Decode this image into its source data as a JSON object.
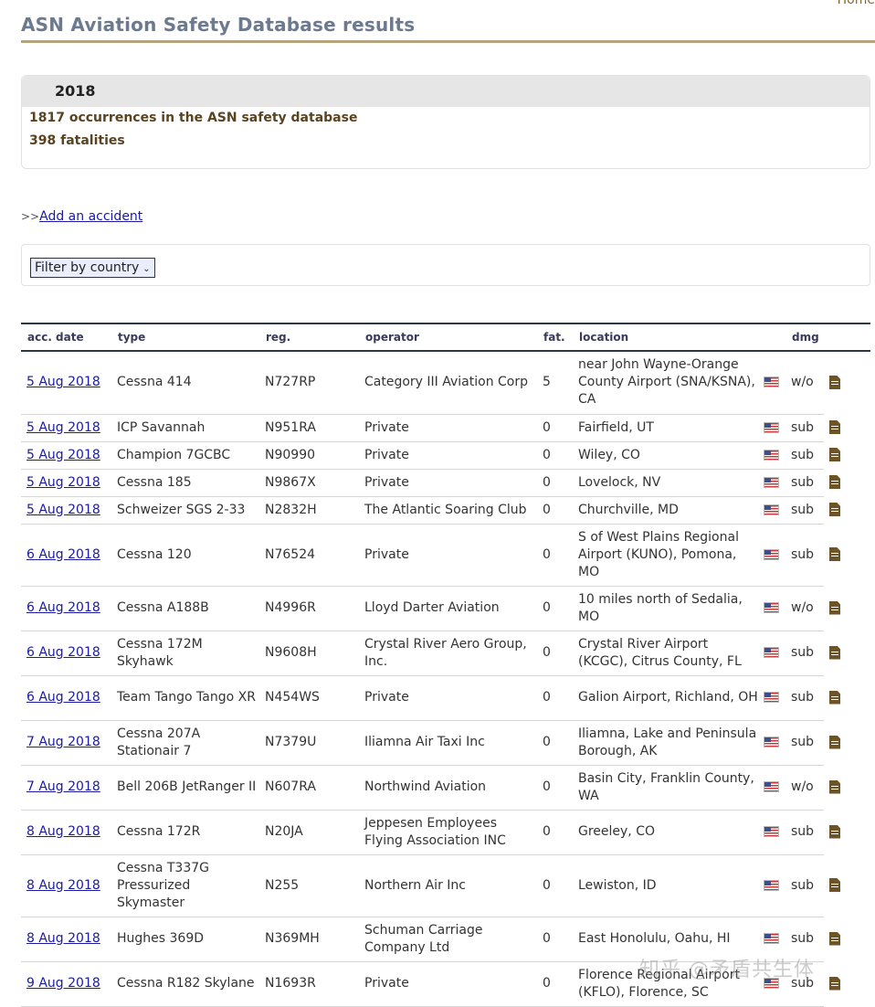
{
  "header": {
    "home_label": "Home",
    "title": "ASN Aviation Safety Database results"
  },
  "stats": {
    "year": "2018",
    "occurrences": "1817 occurrences in the ASN safety database",
    "fatalities": "398 fatalities"
  },
  "add_accident": {
    "arrows": ">>",
    "label": "Add an accident"
  },
  "filter": {
    "selected": "Filter by country"
  },
  "table": {
    "headers": [
      "acc. date",
      "type",
      "reg.",
      "operator",
      "fat.",
      "location",
      "",
      "dmg",
      ""
    ],
    "rows": [
      {
        "date": "5 Aug 2018",
        "type": "Cessna 414",
        "reg": "N727RP",
        "operator": "Category III Aviation Corp",
        "fat": "5",
        "location": "near John Wayne-Orange County Airport (SNA/KSNA), CA",
        "dmg": "w/o",
        "h": 69
      },
      {
        "date": "5 Aug 2018",
        "type": "ICP Savannah",
        "reg": "N951RA",
        "operator": "Private",
        "fat": "0",
        "location": "Fairfield, UT",
        "dmg": "sub",
        "h": 30
      },
      {
        "date": "5 Aug 2018",
        "type": "Champion 7GCBC",
        "reg": "N90990",
        "operator": "Private",
        "fat": "0",
        "location": "Wiley, CO",
        "dmg": "sub",
        "h": 30
      },
      {
        "date": "5 Aug 2018",
        "type": "Cessna 185",
        "reg": "N9867X",
        "operator": "Private",
        "fat": "0",
        "location": "Lovelock, NV",
        "dmg": "sub",
        "h": 30
      },
      {
        "date": "5 Aug 2018",
        "type": "Schweizer SGS 2-33",
        "reg": "N2832H",
        "operator": "The Atlantic Soaring Club",
        "fat": "0",
        "location": "Churchville, MD",
        "dmg": "sub",
        "h": 30
      },
      {
        "date": "6 Aug 2018",
        "type": "Cessna 120",
        "reg": "N76524",
        "operator": "Private",
        "fat": "0",
        "location": "S of West Plains Regional Airport (KUNO), Pomona, MO",
        "dmg": "sub",
        "h": 68
      },
      {
        "date": "6 Aug 2018",
        "type": "Cessna A188B",
        "reg": "N4996R",
        "operator": "Lloyd Darter Aviation",
        "fat": "0",
        "location": "10 miles north of Sedalia, MO",
        "dmg": "w/o",
        "h": 49
      },
      {
        "date": "6 Aug 2018",
        "type": "Cessna 172M Skyhawk",
        "reg": "N9608H",
        "operator": "Crystal River Aero Group, Inc.",
        "fat": "0",
        "location": "Crystal River Airport (KCGC), Citrus County, FL",
        "dmg": "sub",
        "h": 49
      },
      {
        "date": "6 Aug 2018",
        "type": "Team Tango Tango XR",
        "reg": "N454WS",
        "operator": "Private",
        "fat": "0",
        "location": "Galion Airport, Richland, OH",
        "dmg": "sub",
        "h": 49
      },
      {
        "date": "7 Aug 2018",
        "type": "Cessna 207A Stationair 7",
        "reg": "N7379U",
        "operator": "Iliamna Air Taxi Inc",
        "fat": "0",
        "location": "Iliamna, Lake and Peninsula Borough, AK",
        "dmg": "sub",
        "h": 49
      },
      {
        "date": "7 Aug 2018",
        "type": "Bell 206B JetRanger II",
        "reg": "N607RA",
        "operator": "Northwind Aviation",
        "fat": "0",
        "location": "Basin City, Franklin County, WA",
        "dmg": "w/o",
        "h": 49
      },
      {
        "date": "8 Aug 2018",
        "type": "Cessna 172R",
        "reg": "N20JA",
        "operator": "Jeppesen Employees Flying Association INC",
        "fat": "0",
        "location": "Greeley, CO",
        "dmg": "sub",
        "h": 49
      },
      {
        "date": "8 Aug 2018",
        "type": "Cessna T337G Pressurized Skymaster",
        "reg": "N255",
        "operator": "Northern Air Inc",
        "fat": "0",
        "location": "Lewiston, ID",
        "dmg": "sub",
        "h": 68
      },
      {
        "date": "8 Aug 2018",
        "type": "Hughes 369D",
        "reg": "N369MH",
        "operator": "Schuman Carriage Company Ltd",
        "fat": "0",
        "location": "East Honolulu, Oahu, HI",
        "dmg": "sub",
        "h": 49
      },
      {
        "date": "9 Aug 2018",
        "type": "Cessna R182 Skylane",
        "reg": "N1693R",
        "operator": "Private",
        "fat": "0",
        "location": "Florence Regional Airport (KFLO), Florence, SC",
        "dmg": "sub",
        "h": 49
      }
    ]
  },
  "icons": {
    "flag": "us-flag-icon",
    "document": "document-icon"
  },
  "watermark": "知乎 @矛盾共生体"
}
